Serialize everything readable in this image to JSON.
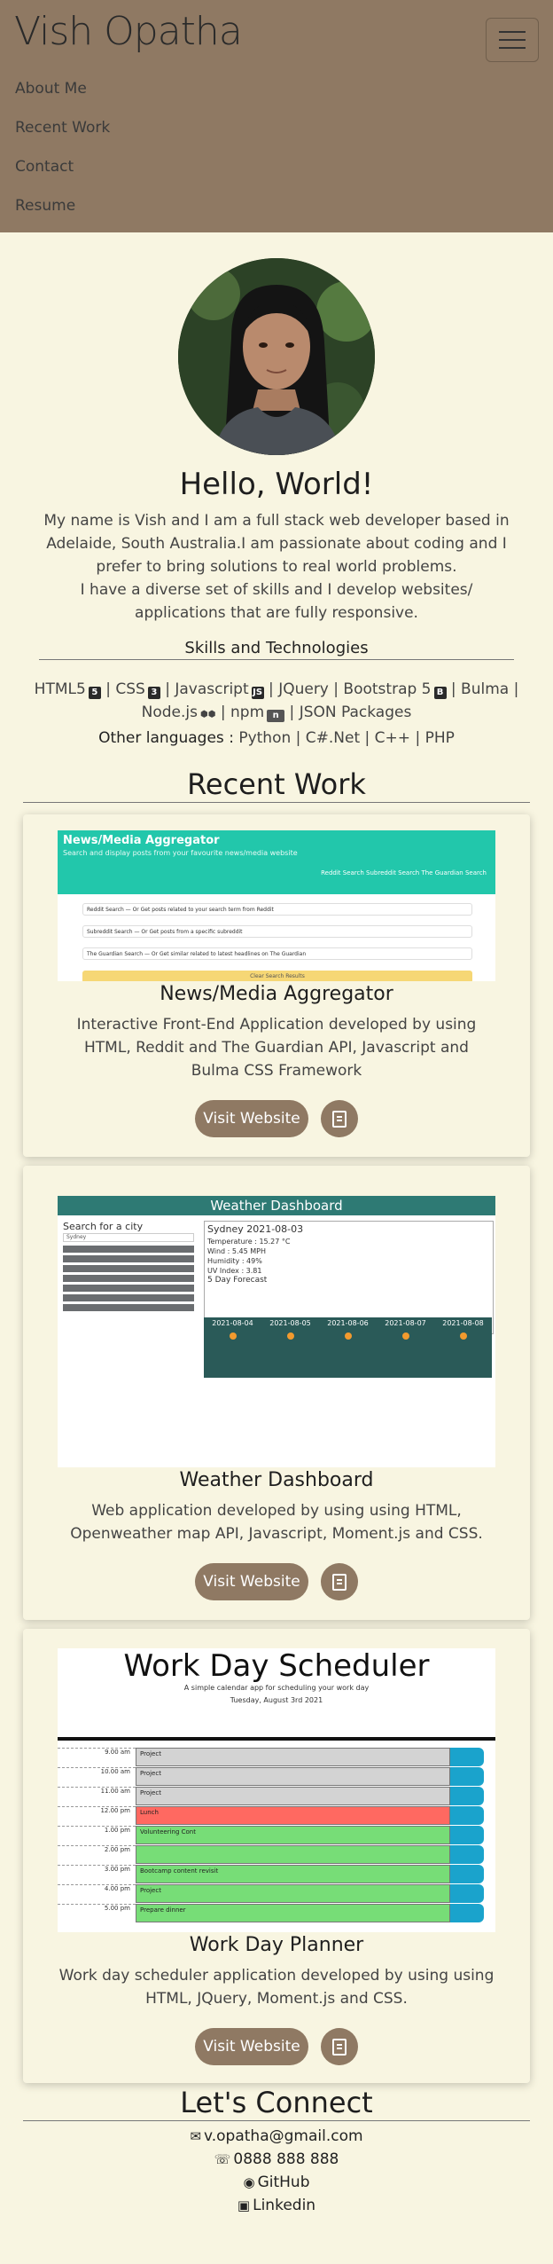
{
  "nav": {
    "brand": "Vish Opatha",
    "links": [
      "About Me",
      "Recent Work",
      "Contact",
      "Resume"
    ]
  },
  "about": {
    "heading": "Hello, World!",
    "p1": "My name is Vish and I am a full stack web developer based in Adelaide, South Australia.I am passionate about coding and I prefer to bring solutions to real world problems.",
    "p2": "I have a diverse set of skills and I develop websites/ applications that are fully responsive.",
    "skills_heading": "Skills and Technologies",
    "skills": {
      "html5": "HTML5",
      "css": "CSS",
      "javascript": "Javascript",
      "jquery": "JQuery",
      "bootstrap": "Bootstrap 5",
      "bulma": "Bulma",
      "node": "Node.js",
      "npm": "npm",
      "json": "JSON Packages",
      "sep": " | ",
      "other_label": "Other languages :",
      "other": "Python | C#.Net | C++ | PHP"
    }
  },
  "recent_work": {
    "heading": "Recent Work",
    "projects": [
      {
        "title": "News/Media Aggregator",
        "description": "Interactive Front-End Application developed by using HTML, Reddit and The Guardian API, Javascript and Bulma CSS Framework",
        "button": "Visit Website",
        "screenshot": {
          "title": "News/Media Aggregator",
          "subtitle": "Search and display posts from your favourite news/media website",
          "links": "Reddit Search     Subreddit Search     The Guardian Search",
          "rows": [
            "Reddit Search — Or Get posts related to your search term from Reddit",
            "Subreddit Search — Or Get posts from a specific subreddit",
            "The Guardian Search — Or Get similar related to latest headlines on The Guardian"
          ],
          "clear": "Clear Search Results"
        }
      },
      {
        "title": "Weather Dashboard",
        "description": "Web application developed by using using HTML, Openweather map API, Javascript, Moment.js and CSS.",
        "button": "Visit Website",
        "screenshot": {
          "title": "Weather Dashboard",
          "search_label": "Search for a city",
          "input_value": "Sydney",
          "cities": [
            "Search",
            "Adelaide",
            "Sydney",
            "Melbourne",
            "Canberra",
            "Darwin",
            "Alice Springs"
          ],
          "city_date": "Sydney 2021-08-03",
          "details": [
            "Temperature : 15.27 °C",
            "Wind : 5.45 MPH",
            "Humidity : 49%",
            "UV Index : 3.81"
          ],
          "forecast_label": "5 Day Forecast",
          "forecast_dates": [
            "2021-08-04",
            "2021-08-05",
            "2021-08-06",
            "2021-08-07",
            "2021-08-08"
          ]
        }
      },
      {
        "title": "Work Day Planner",
        "description": "Work day scheduler application developed by using using HTML, JQuery, Moment.js and CSS.",
        "button": "Visit Website",
        "screenshot": {
          "title": "Work Day Scheduler",
          "subtitle": "A simple calendar app for scheduling your work day",
          "date": "Tuesday, August 3rd 2021",
          "rows": [
            {
              "time": "9.00 am",
              "task": "Project",
              "color": "#d3d3d3"
            },
            {
              "time": "10.00 am",
              "task": "Project",
              "color": "#d3d3d3"
            },
            {
              "time": "11.00 am",
              "task": "Project",
              "color": "#d3d3d3"
            },
            {
              "time": "12.00 pm",
              "task": "Lunch",
              "color": "#ff6961"
            },
            {
              "time": "1.00 pm",
              "task": "Volunteering Cont",
              "color": "#77dd77"
            },
            {
              "time": "2.00 pm",
              "task": "",
              "color": "#77dd77"
            },
            {
              "time": "3.00 pm",
              "task": "Bootcamp content revisit",
              "color": "#77dd77"
            },
            {
              "time": "4.00 pm",
              "task": "Project",
              "color": "#77dd77"
            },
            {
              "time": "5.00 pm",
              "task": "Prepare dinner",
              "color": "#77dd77"
            }
          ]
        }
      }
    ]
  },
  "connect": {
    "heading": "Let's Connect",
    "email": "v.opatha@gmail.com",
    "phone": "0888 888 888",
    "github": "GitHub",
    "linkedin": "Linkedin"
  }
}
